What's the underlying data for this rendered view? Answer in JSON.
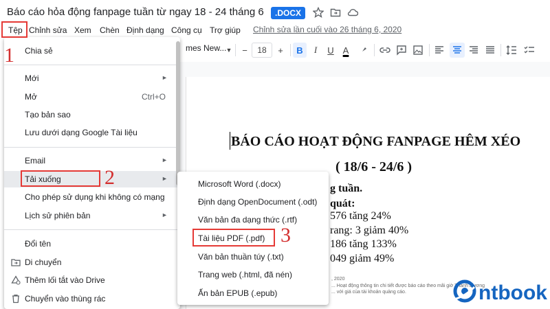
{
  "header": {
    "title": "Báo cáo hỏa động fanpage tuần từ ngay 18 - 24 tháng 6",
    "format_badge": ".DOCX",
    "icons": [
      "star-icon",
      "folder-move-icon",
      "cloud-status-icon"
    ]
  },
  "menubar": {
    "items": [
      "Tệp",
      "Chỉnh sửa",
      "Xem",
      "Chèn",
      "Định dạng",
      "Công cụ",
      "Trợ giúp"
    ],
    "last_edit": "Chỉnh sửa lần cuối vào 26 tháng 6, 2020"
  },
  "toolbar": {
    "font_name": "mes New...",
    "font_size": "18",
    "minus": "−",
    "plus": "+",
    "bold": "B",
    "italic": "I",
    "underline": "U",
    "text_color": "A"
  },
  "file_menu": {
    "items": [
      {
        "label": "Chia sẻ"
      },
      {
        "label": "Mới",
        "submenu": true
      },
      {
        "label": "Mở",
        "shortcut": "Ctrl+O"
      },
      {
        "label": "Tạo bản sao"
      },
      {
        "label": "Lưu dưới dạng Google Tài liệu"
      },
      {
        "label": "Email",
        "submenu": true
      },
      {
        "label": "Tải xuống",
        "submenu": true
      },
      {
        "label": "Cho phép sử dụng khi không có mạng"
      },
      {
        "label": "Lịch sử phiên bản",
        "submenu": true
      },
      {
        "label": "Đổi tên"
      },
      {
        "label": "Di chuyển",
        "icon": "folder-move-icon"
      },
      {
        "label": "Thêm lối tắt vào Drive",
        "icon": "drive-shortcut-icon"
      },
      {
        "label": "Chuyển vào thùng rác",
        "icon": "trash-icon"
      }
    ]
  },
  "download_submenu": {
    "items": [
      "Microsoft Word (.docx)",
      "Định dạng OpenDocument (.odt)",
      "Văn bản đa dạng thức (.rtf)",
      "Tài liệu PDF (.pdf)",
      "Văn bản thuần túy (.txt)",
      "Trang web (.html, đã nén)",
      "Ấn bản EPUB (.epub)"
    ]
  },
  "annotations": {
    "step1": "1",
    "step2": "2",
    "step3": "3",
    "color": "#e53935"
  },
  "document": {
    "heading": "BÁO CÁO HOẠT ĐỘNG FANPAGE HÊM XÉO",
    "subheading": "( 18/6 - 24/6 )",
    "lines": [
      "g tuần.",
      "quát:",
      "576 tăng 24%",
      "rang: 3 giảm 40%",
      "186 tăng 133%",
      "049 giảm 49%"
    ],
    "tiny_1": ", 2020",
    "tiny_2": "... Hoạt động thông tin chi tiết được báo cáo theo mãi giờ Thành Dương",
    "tiny_3": "... với giá của tài khoản quảng cáo."
  },
  "watermark": {
    "text": "ntbook",
    "color": "#1565c0"
  }
}
